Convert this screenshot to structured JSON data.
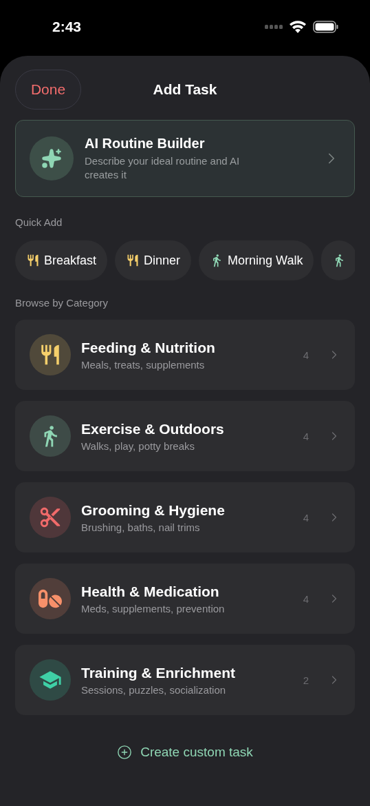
{
  "status_bar": {
    "time": "2:43"
  },
  "header": {
    "done": "Done",
    "title": "Add Task"
  },
  "ai_card": {
    "title": "AI Routine Builder",
    "subtitle": "Describe your ideal routine and AI creates it"
  },
  "quick_add": {
    "label": "Quick Add",
    "chips": [
      {
        "kind": "food",
        "label": "Breakfast"
      },
      {
        "kind": "food",
        "label": "Dinner"
      },
      {
        "kind": "walk",
        "label": "Morning Walk"
      },
      {
        "kind": "walk"
      }
    ]
  },
  "categories": {
    "label": "Browse by Category",
    "items": [
      {
        "kind": "food",
        "color": "#f5cf6b",
        "title": "Feeding & Nutrition",
        "subtitle": "Meals, treats, supplements",
        "count": "4"
      },
      {
        "kind": "walk",
        "color": "#8fd6b4",
        "title": "Exercise & Outdoors",
        "subtitle": "Walks, play, potty breaks",
        "count": "4"
      },
      {
        "kind": "scissors",
        "color": "#f06a6a",
        "title": "Grooming & Hygiene",
        "subtitle": "Brushing, baths, nail trims",
        "count": "4"
      },
      {
        "kind": "pills",
        "color": "#f7906a",
        "title": "Health & Medication",
        "subtitle": "Meds, supplements, prevention",
        "count": "4"
      },
      {
        "kind": "cap",
        "color": "#3fd0a6",
        "title": "Training & Enrichment",
        "subtitle": "Sessions, puzzles, socialization",
        "count": "2"
      }
    ]
  },
  "create_link": "Create custom task"
}
